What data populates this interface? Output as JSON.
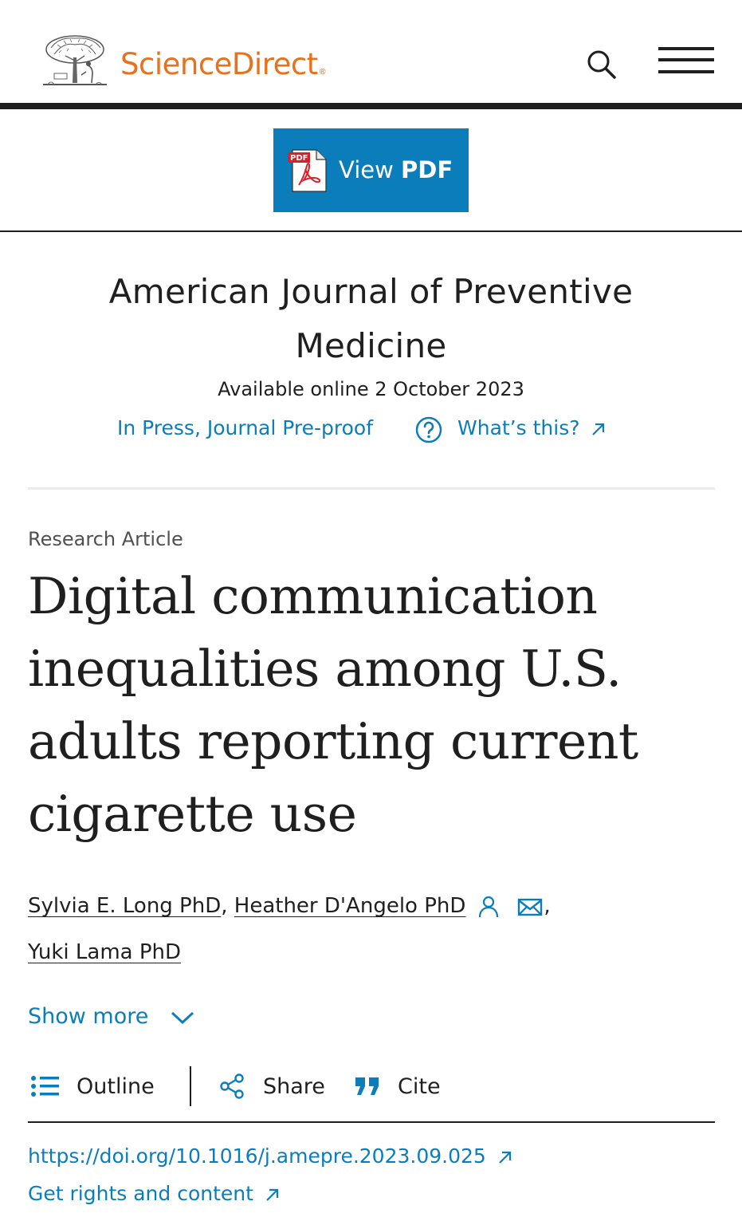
{
  "header": {
    "brand": "ScienceDirect",
    "brand_mark": "®",
    "logo_icon": "elsevier-tree-logo",
    "search_icon": "search-icon",
    "menu_icon": "hamburger-menu-icon"
  },
  "pdf_button": {
    "label_prefix": "View",
    "label_strong": "PDF",
    "icon": "pdf-file-icon",
    "icon_text": "PDF"
  },
  "journal": {
    "title": "American Journal of Preventive Medicine",
    "available": "Available online 2 October 2023",
    "status": "In Press, Journal Pre-proof",
    "help_link": "What’s this?"
  },
  "article": {
    "type": "Research Article",
    "title": "Digital communication inequalities among U.S. adults reporting current cigarette use",
    "authors": [
      {
        "name": "Sylvia E. Long PhD"
      },
      {
        "name": "Heather D'Angelo PhD"
      },
      {
        "name": "Yuki Lama PhD"
      }
    ],
    "show_more": "Show more"
  },
  "toolbar": {
    "outline": "Outline",
    "share": "Share",
    "cite": "Cite"
  },
  "links": {
    "doi": "https://doi.org/10.1016/j.amepre.2023.09.025",
    "rights": "Get rights and content"
  },
  "colors": {
    "brand_orange": "#e9711c",
    "link_blue": "#0c7dbb",
    "text": "#1f1f1f",
    "muted": "#505050"
  }
}
